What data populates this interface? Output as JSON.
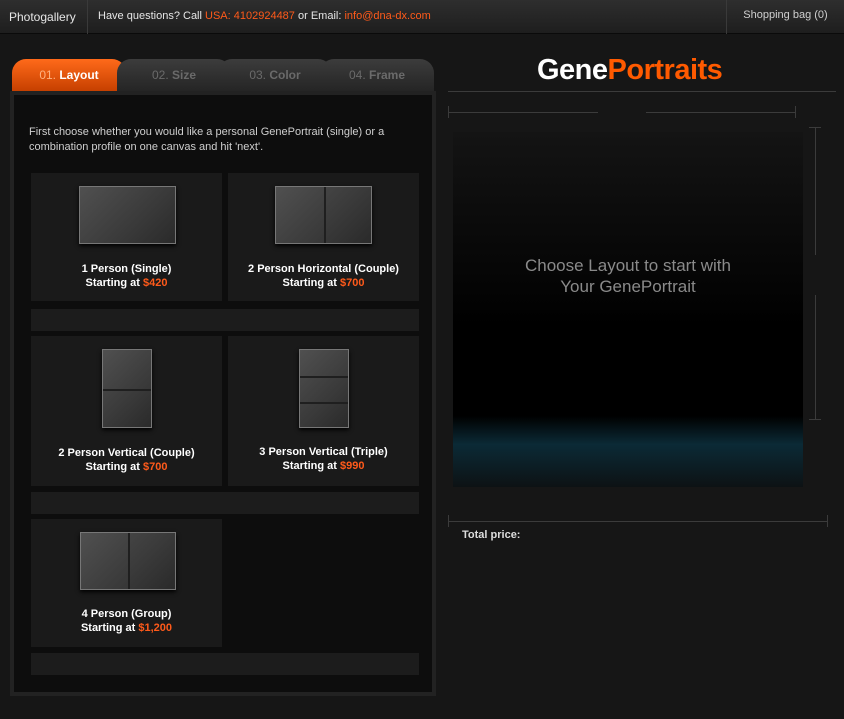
{
  "topbar": {
    "brand": "Photogallery",
    "contact_prefix": "Have questions? Call ",
    "phone": "USA: 4102924487",
    "contact_mid": " or Email: ",
    "email": "info@dna-dx.com",
    "cart": "Shopping bag (0)"
  },
  "tabs": [
    {
      "num": "01.",
      "label": "Layout",
      "active": true
    },
    {
      "num": "02.",
      "label": "Size",
      "active": false
    },
    {
      "num": "03.",
      "label": "Color",
      "active": false
    },
    {
      "num": "04.",
      "label": "Frame",
      "active": false
    }
  ],
  "intro": "First choose whether you would like a personal GenePortrait (single) or a combination profile on one canvas and hit 'next'.",
  "layouts": [
    {
      "name": "1 Person (Single)",
      "price_prefix": "Starting at ",
      "price": "$420"
    },
    {
      "name": "2 Person Horizontal (Couple)",
      "price_prefix": "Starting at ",
      "price": "$700"
    },
    {
      "name": "2 Person Vertical (Couple)",
      "price_prefix": "Starting at ",
      "price": "$700"
    },
    {
      "name": "3 Person Vertical (Triple)",
      "price_prefix": "Starting at ",
      "price": "$990"
    },
    {
      "name": "4 Person (Group)",
      "price_prefix": "Starting at ",
      "price": "$1,200"
    }
  ],
  "logo": {
    "part1": "Gene",
    "part2": "Portraits"
  },
  "preview": {
    "line1": "Choose Layout to start with",
    "line2": "Your GenePortrait"
  },
  "total_label": "Total price:",
  "colors": {
    "accent": "#ff5a1a",
    "background": "#161616"
  }
}
